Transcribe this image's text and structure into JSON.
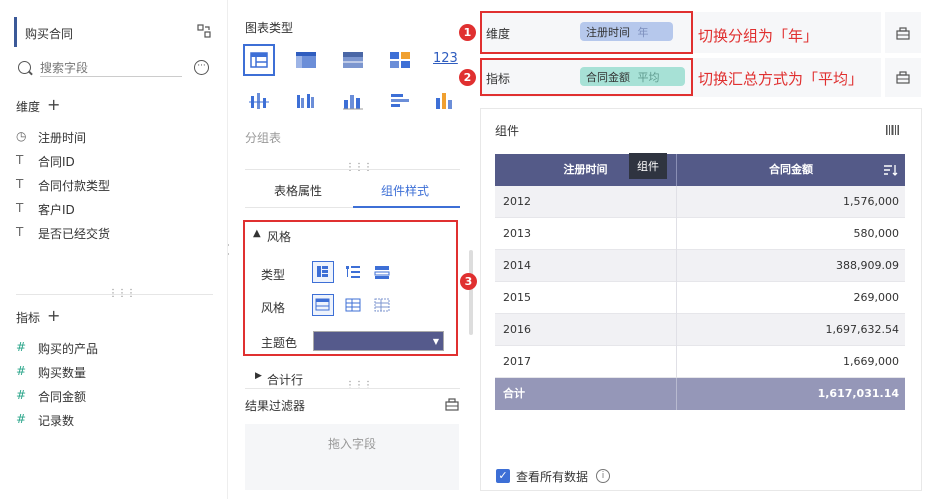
{
  "left": {
    "dataset": "购买合同",
    "search_placeholder": "搜索字段",
    "dimension_header": "维度",
    "dimension_fields": [
      {
        "icon": "clock-icon",
        "label": "注册时间"
      },
      {
        "icon": "text-icon",
        "label": "合同ID"
      },
      {
        "icon": "text-icon",
        "label": "合同付款类型"
      },
      {
        "icon": "text-icon",
        "label": "客户ID"
      },
      {
        "icon": "text-icon",
        "label": "是否已经交货"
      }
    ],
    "measure_header": "指标",
    "measure_fields": [
      {
        "icon": "hash-icon",
        "label": "购买的产品"
      },
      {
        "icon": "hash-icon",
        "label": "购买数量"
      },
      {
        "icon": "hash-icon",
        "label": "合同金额"
      },
      {
        "icon": "hash-record-icon",
        "label": "记录数"
      }
    ]
  },
  "middle": {
    "chart_type_title": "图表类型",
    "chart_type_name": "分组表",
    "chart_number_label": "123",
    "tabs": [
      "表格属性",
      "组件样式"
    ],
    "style_section": "风格",
    "type_label": "类型",
    "style_label": "风格",
    "theme_label": "主题色",
    "theme_color": "#555a8c",
    "subtotal_label": "合计行",
    "filter_title": "结果过滤器",
    "drop_placeholder": "拖入字段"
  },
  "right": {
    "dimension_label": "维度",
    "dimension_chip_field": "注册时间",
    "dimension_chip_agg": "年",
    "measure_label": "指标",
    "measure_chip_field": "合同金额",
    "measure_chip_agg": "平均",
    "annotation_1": "切换分组为「年」",
    "annotation_2": "切换汇总方式为「平均」",
    "badge_1": "1",
    "badge_2": "2",
    "badge_3": "3",
    "component_title": "组件",
    "tooltip": "组件",
    "table": {
      "headers": [
        "注册时间",
        "合同金额"
      ],
      "rows": [
        [
          "2012",
          "1,576,000"
        ],
        [
          "2013",
          "580,000"
        ],
        [
          "2014",
          "388,909.09"
        ],
        [
          "2015",
          "269,000"
        ],
        [
          "2016",
          "1,697,632.54"
        ],
        [
          "2017",
          "1,669,000"
        ]
      ],
      "total": [
        "合计",
        "1,617,031.14"
      ]
    },
    "view_all_label": "查看所有数据"
  },
  "colors": {
    "accent": "#3d6fd6",
    "header": "#545a88",
    "total": "#9597b8",
    "annotation": "#e03030"
  }
}
